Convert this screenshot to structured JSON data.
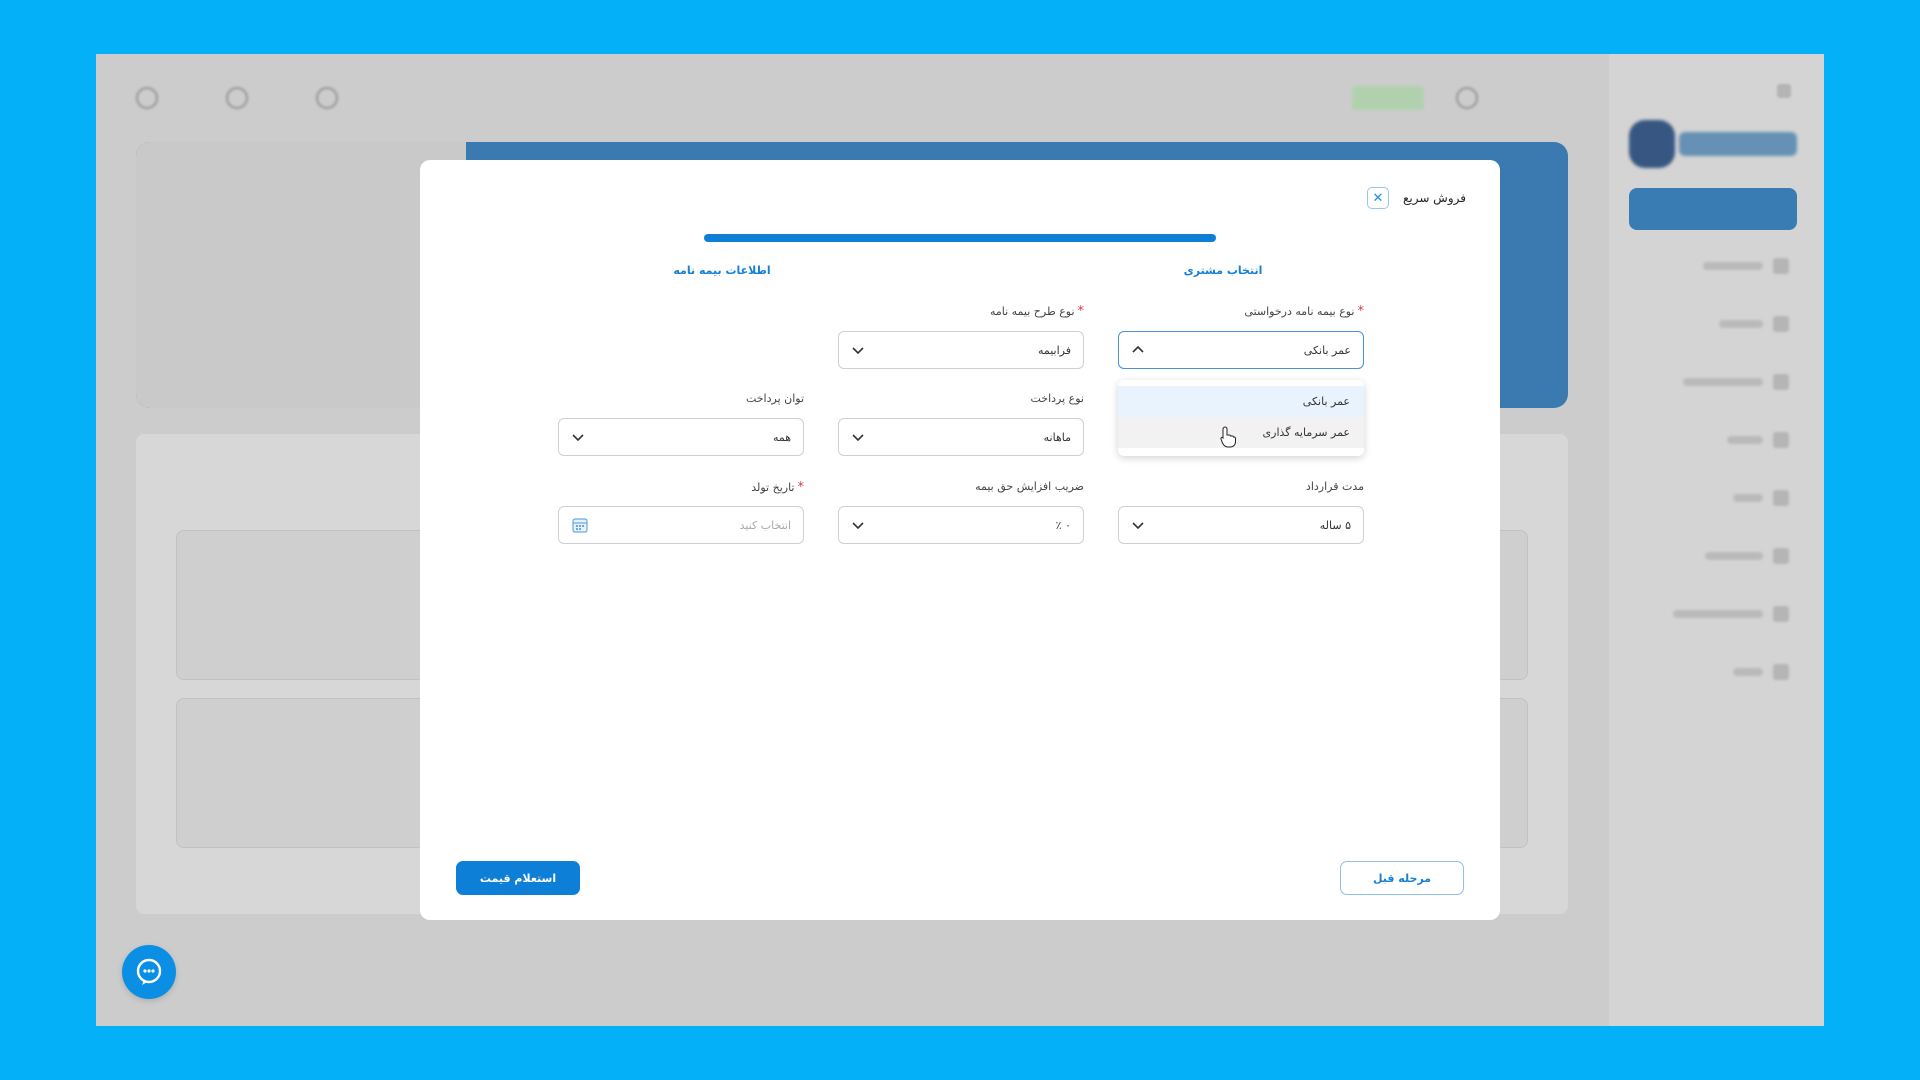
{
  "modal": {
    "title": "فروش سریع",
    "close_symbol": "✕",
    "progress_percent": 100,
    "steps": [
      "انتخاب مشتری",
      "اطلاعات بیمه نامه"
    ],
    "fields": {
      "policy_type": {
        "label": "نوع بیمه نامه درخواستی",
        "value": "عمر بانکی",
        "required": true
      },
      "plan_type": {
        "label": "نوع طرح بیمه نامه",
        "value": "فرابیمه",
        "required": true
      },
      "payment_type": {
        "label": "نوع پرداخت",
        "value": "ماهانه"
      },
      "payment_ability": {
        "label": "توان پرداخت",
        "value": "همه"
      },
      "contract_duration": {
        "label": "مدت قرارداد",
        "value": "۵ ساله"
      },
      "premium_increase": {
        "label": "ضریب افزایش حق بیمه",
        "value": "۰ ٪"
      },
      "birth_date": {
        "label": "تاریخ تولد",
        "placeholder": "انتخاب کنید",
        "required": true
      }
    },
    "dropdown_options": [
      "عمر بانکی",
      "عمر سرمایه گذاری"
    ],
    "buttons": {
      "prev": "مرحله قبل",
      "quote": "استعلام قیمت"
    },
    "required_mark": "*"
  },
  "colors": {
    "accent": "#0d7fd6",
    "background": "#04b1f9",
    "required": "#e23b3b"
  },
  "icons": {
    "chat": "chat-bubble-icon",
    "calendar": "calendar-icon",
    "chevron": "chevron-down-icon"
  }
}
